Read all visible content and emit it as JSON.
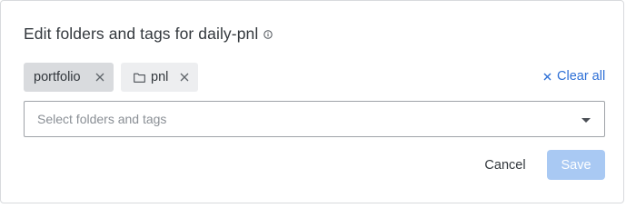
{
  "dialog": {
    "title": "Edit folders and tags for daily-pnl",
    "info_icon": "info-circle-icon"
  },
  "chips": [
    {
      "label": "portfolio",
      "icon": null,
      "close_icon": "close-icon"
    },
    {
      "label": "pnl",
      "icon": "folder-icon",
      "close_icon": "close-icon"
    }
  ],
  "clear_all": {
    "label": "Clear all",
    "icon": "close-icon",
    "color": "#2d6fd6"
  },
  "select": {
    "placeholder": "Select folders and tags",
    "value": "",
    "icon": "chevron-down-icon"
  },
  "actions": {
    "cancel_label": "Cancel",
    "save_label": "Save",
    "save_disabled": true,
    "save_color": "#a9c9f3"
  }
}
